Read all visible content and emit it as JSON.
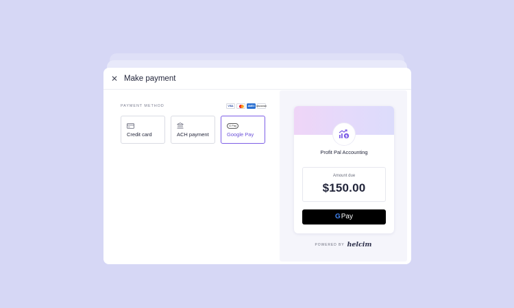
{
  "modal": {
    "title": "Make payment",
    "close_icon": "close-icon"
  },
  "payment_method": {
    "section_label": "PAYMENT METHOD",
    "card_logos": [
      "VISA",
      "Mastercard",
      "AMEX",
      "DISCOVER"
    ],
    "options": [
      {
        "label": "Credit card",
        "icon": "credit-card-icon",
        "selected": false
      },
      {
        "label": "ACH payment",
        "icon": "bank-icon",
        "selected": false
      },
      {
        "label": "Google Pay",
        "icon": "google-pay-icon",
        "icon_text": "G Pay",
        "selected": true
      }
    ]
  },
  "invoice": {
    "business_name": "Profit Pal Accounting",
    "business_icon": "growth-chart-dollar-icon",
    "amount_label": "Amount due",
    "amount": "$150.00",
    "pay_button": {
      "logo_letter": "G",
      "label": "Pay"
    }
  },
  "footer": {
    "powered_by": "POWERED BY",
    "brand": "helcim"
  },
  "colors": {
    "background": "#d6d7f5",
    "accent": "#7b5ce6",
    "pay_button": "#000000"
  }
}
